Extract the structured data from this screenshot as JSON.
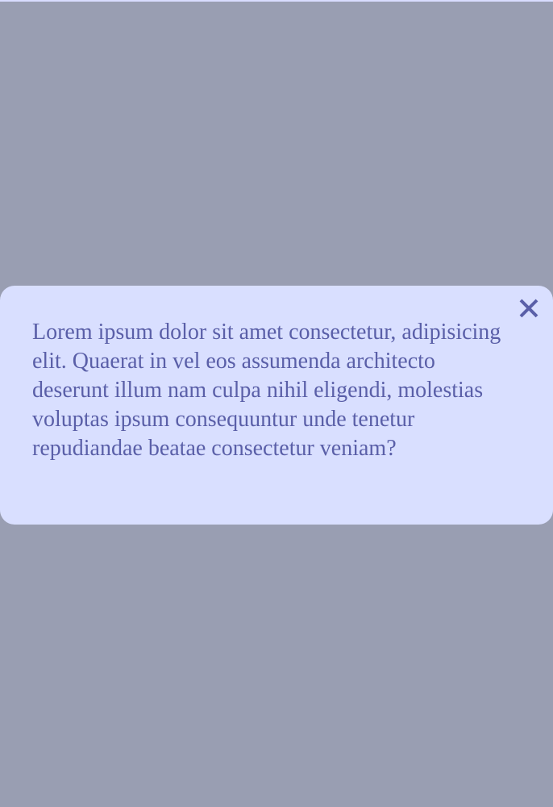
{
  "colors": {
    "overlay": "#999eb2",
    "modal_background": "#d9dfff",
    "text": "#5a5fa8",
    "close_icon": "#5a5fa8"
  },
  "modal": {
    "body_text": "Lorem ipsum dolor sit amet consectetur, adipisicing elit. Quaerat in vel eos assumenda architecto deserunt illum nam culpa nihil eligendi, molestias voluptas ipsum consequuntur unde tenetur repudiandae beatae consectetur veniam?",
    "close_icon": "close-icon"
  }
}
